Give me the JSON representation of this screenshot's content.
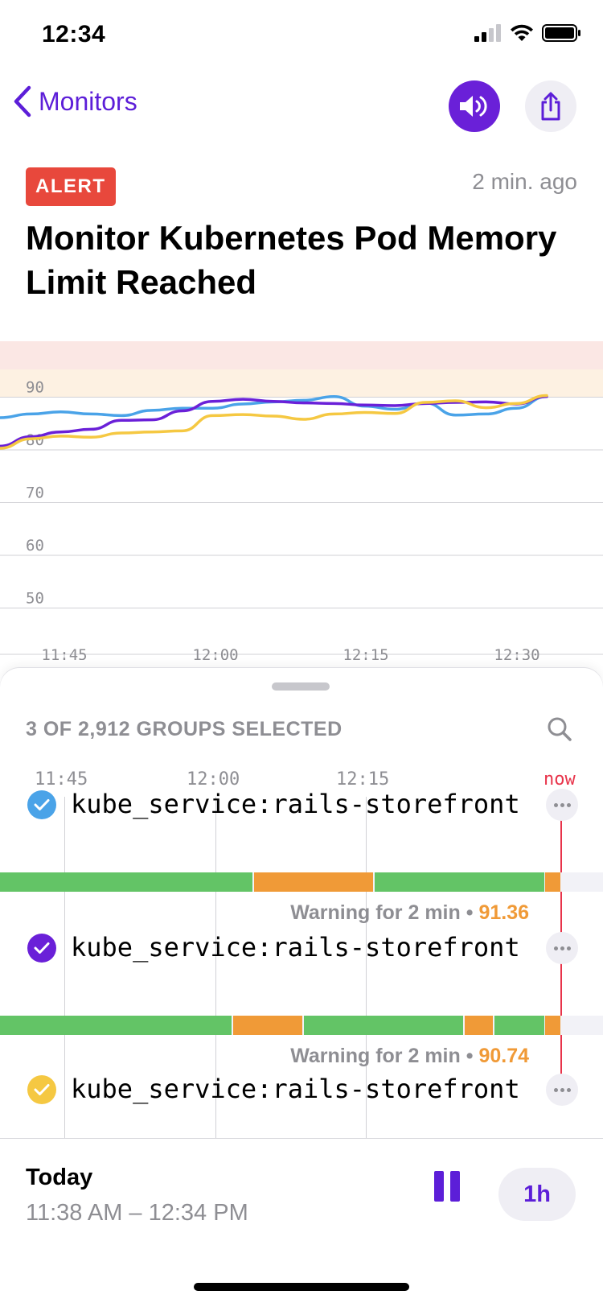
{
  "status_bar": {
    "time": "12:34"
  },
  "nav": {
    "back_label": "Monitors"
  },
  "alert": {
    "badge": "ALERT",
    "time_ago": "2 min. ago",
    "title": "Monitor Kubernetes Pod Memory Limit Reached"
  },
  "chart_data": {
    "type": "line",
    "yticks": [
      "90",
      "80",
      "70",
      "60",
      "50"
    ],
    "xticks": [
      "11:45",
      "12:00",
      "12:15",
      "12:30"
    ],
    "thresholds": {
      "alert_color": "#fbe7e4",
      "warning_color": "#fdf1e2"
    },
    "series": [
      {
        "color": "#4aa3e8",
        "values": [
          85.8,
          86.5,
          86.9,
          86.5,
          86.2,
          87.2,
          87.6,
          87.6,
          88.4,
          88.8,
          89.1,
          89.8,
          88.0,
          87.4,
          88.6,
          86.3,
          86.5,
          87.6,
          89.8
        ]
      },
      {
        "color": "#6a20d8",
        "values": [
          80.4,
          82.2,
          83.1,
          83.6,
          85.3,
          85.4,
          87.1,
          88.9,
          89.3,
          88.9,
          88.6,
          88.5,
          88.2,
          88.1,
          88.5,
          88.7,
          88.8,
          88.4,
          89.8
        ]
      },
      {
        "color": "#f5c842",
        "values": [
          80.0,
          81.8,
          82.3,
          82.1,
          82.9,
          83.1,
          83.3,
          86.2,
          86.4,
          86.1,
          85.5,
          86.5,
          86.8,
          86.6,
          88.7,
          89.0,
          87.7,
          88.5,
          90.0
        ]
      }
    ]
  },
  "sheet": {
    "groups_label": "3 OF 2,912 GROUPS SELECTED",
    "time_axis": [
      "11:45",
      "12:00",
      "12:15"
    ],
    "now_label": "now",
    "rows": [
      {
        "label": "kube_service:rails-storefront",
        "check_color": "#4aa3e8",
        "warning_text": "Warning for 2 min",
        "separator": "•",
        "value": "91.36",
        "segments": [
          [
            "ok",
            0,
            0.418
          ],
          [
            "warn",
            0.421,
            0.619
          ],
          [
            "ok",
            0.621,
            0.902
          ],
          [
            "warn",
            0.904,
            0.929
          ]
        ]
      },
      {
        "label": "kube_service:rails-storefront",
        "check_color": "#6a20d8",
        "warning_text": "Warning for 2 min",
        "separator": "•",
        "value": "90.74",
        "segments": [
          [
            "ok",
            0,
            0.384
          ],
          [
            "warn",
            0.387,
            0.501
          ],
          [
            "ok",
            0.504,
            0.768
          ],
          [
            "warn",
            0.771,
            0.817
          ],
          [
            "ok",
            0.82,
            0.902
          ],
          [
            "warn",
            0.904,
            0.929
          ]
        ]
      },
      {
        "label": "kube_service:rails-storefront",
        "check_color": "#f5c842"
      }
    ]
  },
  "footer": {
    "day": "Today",
    "range": "11:38 AM – 12:34 PM",
    "range_button": "1h"
  }
}
